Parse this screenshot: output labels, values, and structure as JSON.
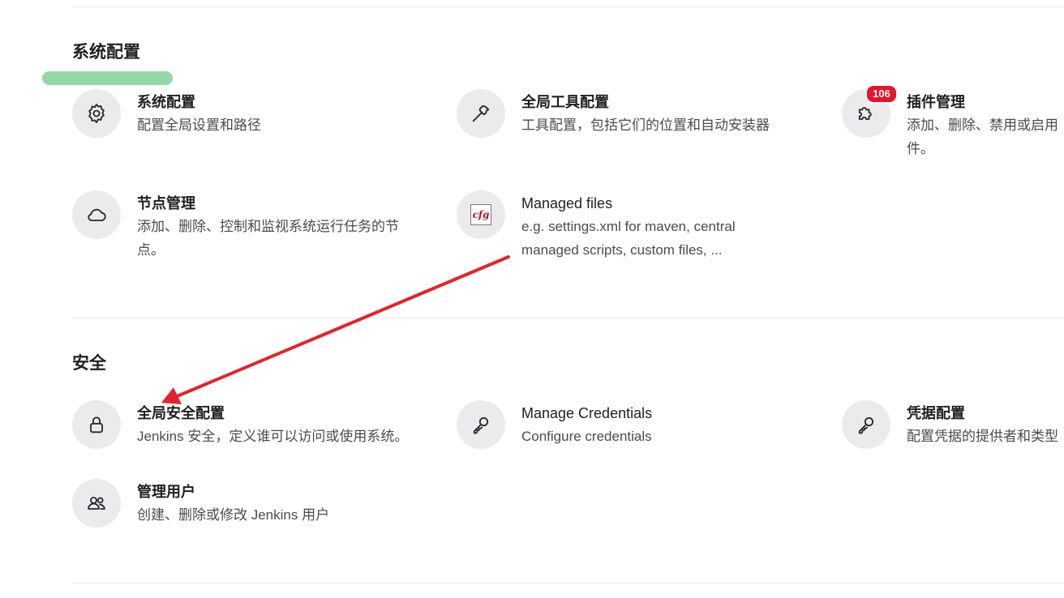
{
  "sections": {
    "system": {
      "title": "系统配置",
      "items": [
        {
          "title": "系统配置",
          "desc": "配置全局设置和路径"
        },
        {
          "title": "全局工具配置",
          "desc": "工具配置，包括它们的位置和自动安装器"
        },
        {
          "title": "插件管理",
          "desc1": "添加、删除、禁用或启用",
          "desc2": "件。",
          "badge": "106"
        },
        {
          "title": "节点管理",
          "desc1": "添加、删除、控制和监视系统运行任务的节",
          "desc2": "点。"
        },
        {
          "title": "Managed files",
          "desc1": "e.g. settings.xml for maven, central",
          "desc2": "managed scripts, custom files, ...",
          "icon_text": "cfg"
        }
      ]
    },
    "security": {
      "title": "安全",
      "items": [
        {
          "title": "全局安全配置",
          "desc": "Jenkins 安全，定义谁可以访问或使用系统。"
        },
        {
          "title": "Manage Credentials",
          "desc": "Configure credentials"
        },
        {
          "title": "凭据配置",
          "desc": "配置凭据的提供者和类型"
        },
        {
          "title": "管理用户",
          "desc": "创建、删除或修改 Jenkins 用户"
        }
      ]
    }
  },
  "icons": {
    "system_settings": "gear-icon",
    "tools": "hammer-icon",
    "plugins": "puzzle-icon",
    "nodes": "cloud-icon",
    "managed_files": "cfg-file-icon",
    "security": "lock-icon",
    "credentials": "key-icon",
    "credential_providers": "key-icon",
    "users": "users-icon"
  },
  "colors": {
    "badge": "#e8152a",
    "annotation_arrow": "#e5222b",
    "highlight": "#94d7a6",
    "icon_bg": "#ebebed"
  }
}
